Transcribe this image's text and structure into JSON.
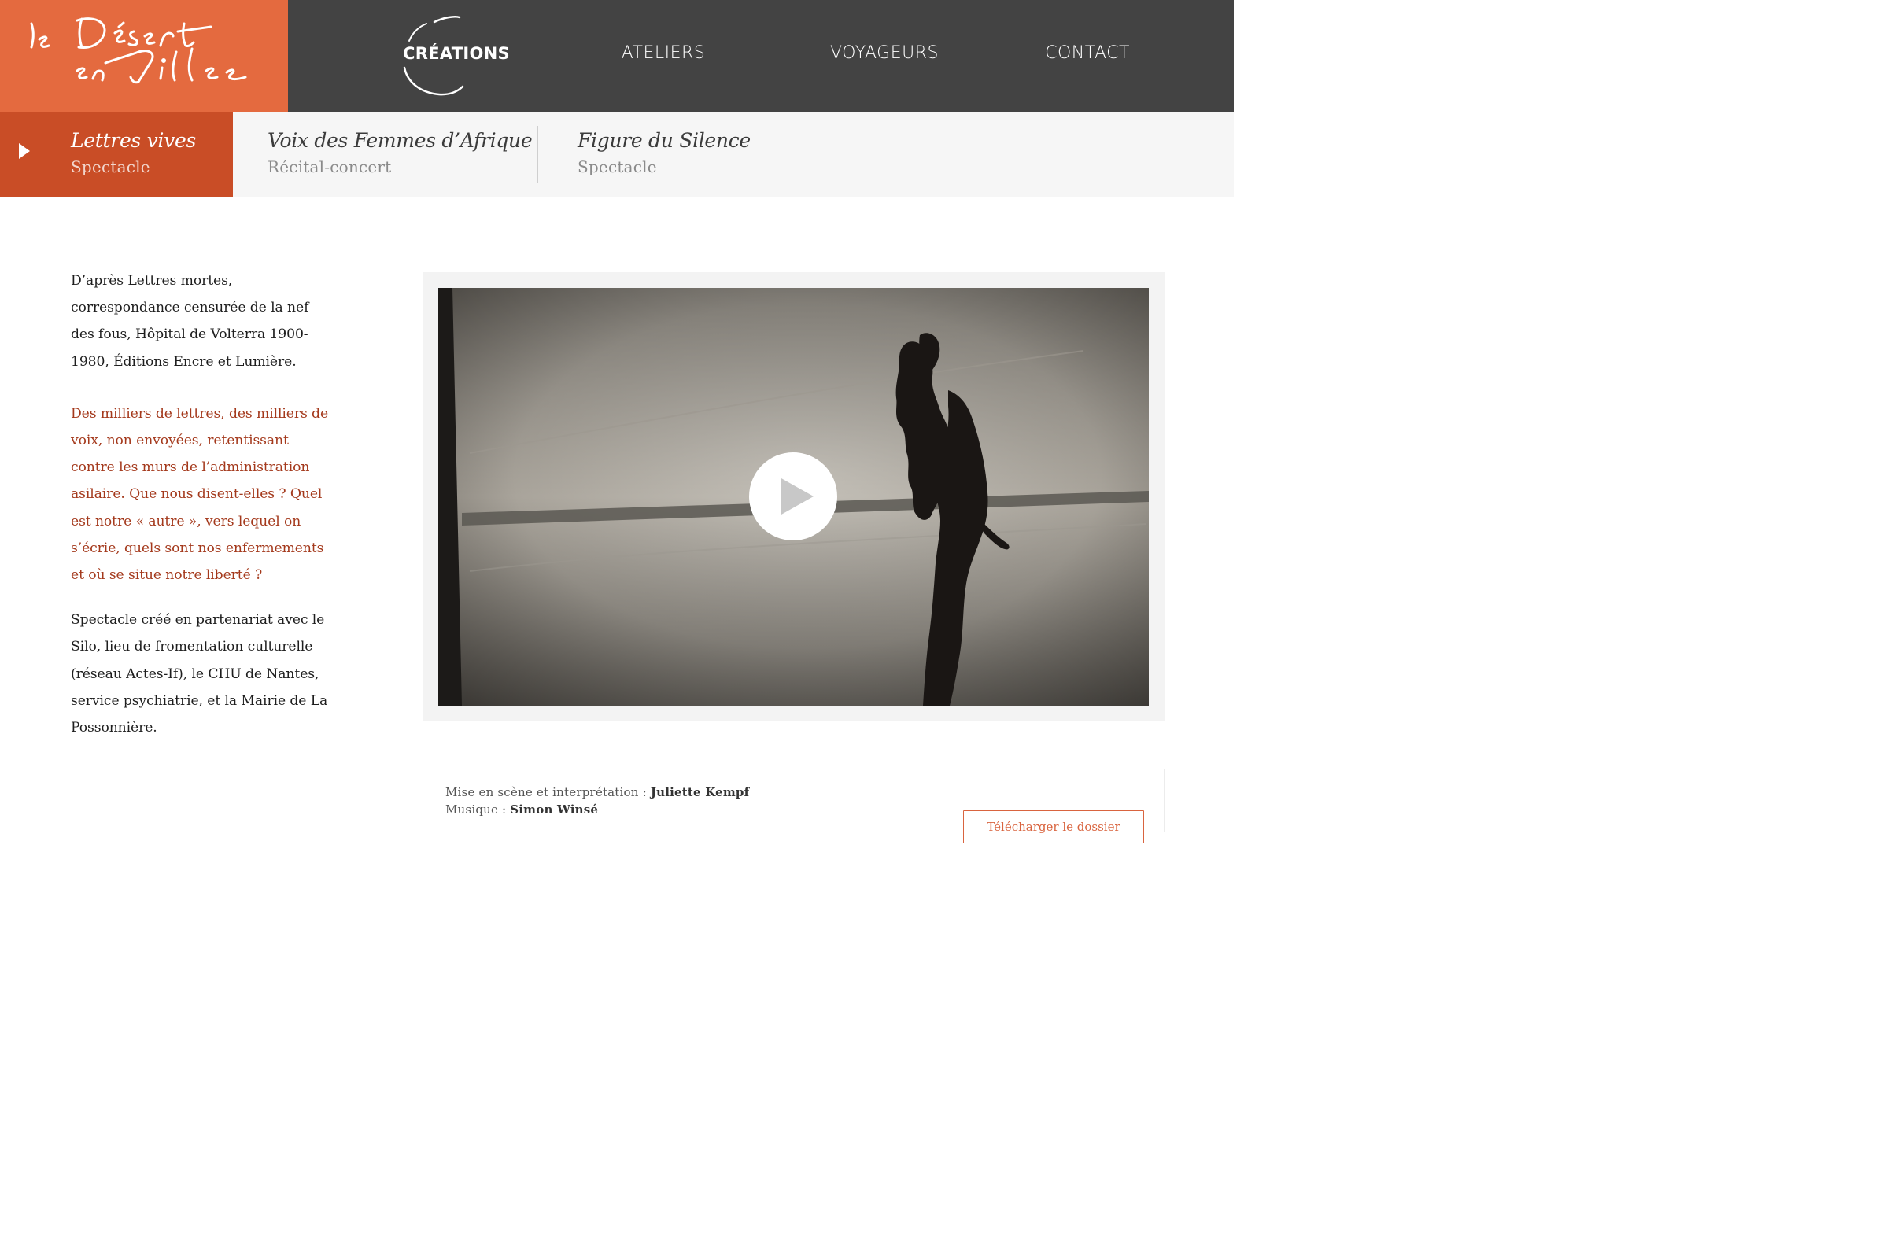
{
  "brand": {
    "logo_text_line1": "le Désert",
    "logo_text_line2": "en Ville",
    "color": "#e46a3f"
  },
  "nav": {
    "items": [
      {
        "label": "CRÉATIONS",
        "active": true
      },
      {
        "label": "ATELIERS"
      },
      {
        "label": "VOYAGEURS"
      },
      {
        "label": "CONTACT"
      }
    ]
  },
  "subnav": {
    "items": [
      {
        "title": "Lettres vives",
        "kind": "Spectacle",
        "active": true
      },
      {
        "title": "Voix des Femmes d’Afrique",
        "kind": "Récital-concert"
      },
      {
        "title": "Figure du Silence",
        "kind": "Spectacle"
      }
    ],
    "active_color": "#c94d26"
  },
  "content": {
    "intro": "D’après Lettres mortes, correspondance censurée de la nef des fous, Hôpital de Volterra 1900-1980, Éditions Encre et Lumière.",
    "quote": "Des milliers de lettres, des milliers de voix, non envoyées, retentissant contre les murs de l’administration asilaire. Que nous disent-elles ? Quel est notre « autre », vers lequel on s’écrie, quels sont nos enfermements et où se situe notre liberté ?",
    "partners": "Spectacle créé en partenariat avec le Silo, lieu de fromentation culturelle (réseau Actes-If), le CHU de Nantes, service psychiatrie, et la Mairie de La Possonnière.",
    "quote_color": "#a4391c"
  },
  "video": {
    "play_icon": "play-icon"
  },
  "credits": {
    "line1_label": "Mise en scène et interprétation : ",
    "line1_value": "Juliette Kempf",
    "line2_label": "Musique : ",
    "line2_value": "Simon Winsé",
    "download_label": "Télécharger le dossier"
  }
}
